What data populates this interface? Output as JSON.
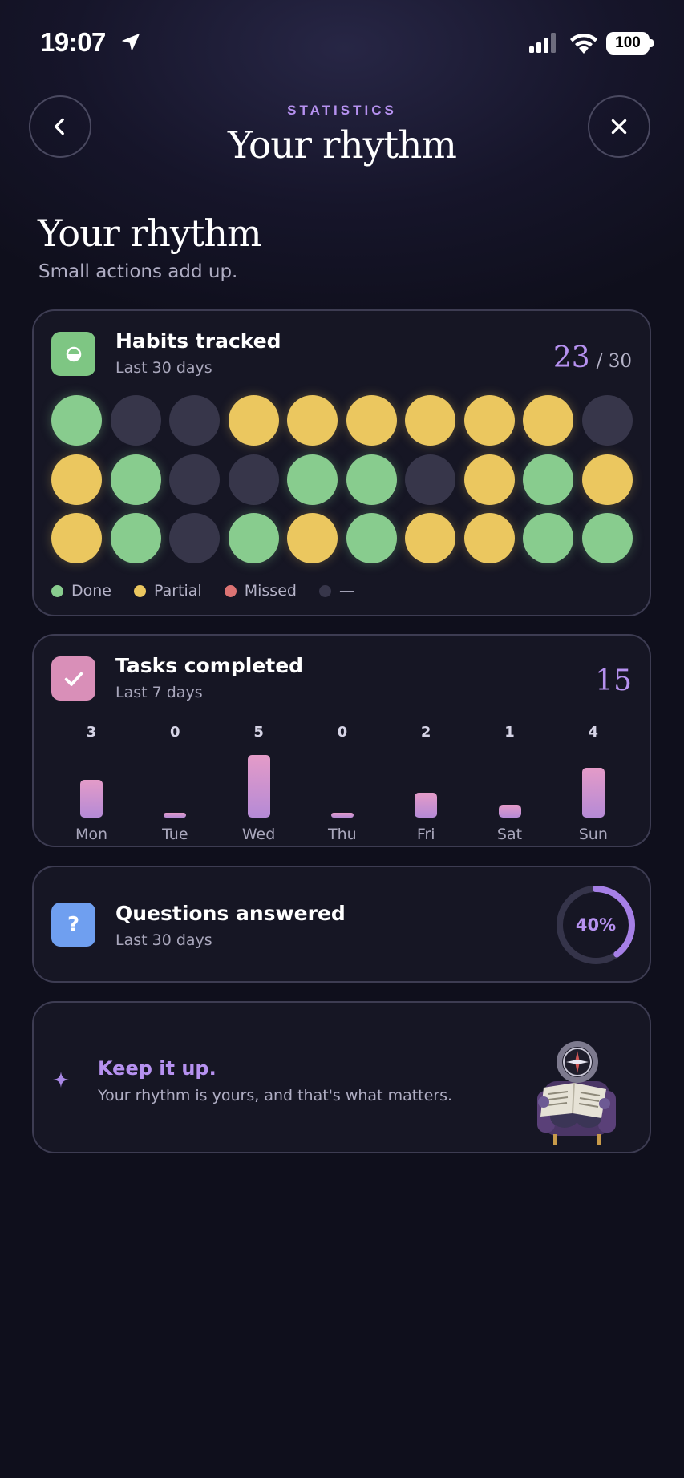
{
  "status_bar": {
    "time": "19:07",
    "battery": "100"
  },
  "header": {
    "kicker": "STATISTICS",
    "title": "Your rhythm"
  },
  "page": {
    "title": "Your rhythm",
    "subtitle": "Small actions add up."
  },
  "habits": {
    "title": "Habits tracked",
    "period": "Last 30 days",
    "count": "23",
    "total": "/ 30",
    "grid": [
      [
        "done",
        "none",
        "none",
        "partial",
        "partial",
        "partial",
        "partial",
        "partial",
        "partial",
        "none"
      ],
      [
        "partial",
        "done",
        "none",
        "none",
        "done",
        "done",
        "none",
        "partial",
        "done",
        "partial"
      ],
      [
        "partial",
        "done",
        "none",
        "done",
        "partial",
        "done",
        "partial",
        "partial",
        "done",
        "done"
      ]
    ],
    "legend": [
      {
        "key": "done",
        "label": "Done",
        "color": "#88cc8e"
      },
      {
        "key": "partial",
        "label": "Partial",
        "color": "#ebc75f"
      },
      {
        "key": "missed",
        "label": "Missed",
        "color": "#dc7373"
      },
      {
        "key": "none",
        "label": "—",
        "color": "#37364a"
      }
    ]
  },
  "tasks": {
    "title": "Tasks completed",
    "period": "Last 7 days",
    "total": "15",
    "chart_data": {
      "type": "bar",
      "categories": [
        "Mon",
        "Tue",
        "Wed",
        "Thu",
        "Fri",
        "Sat",
        "Sun"
      ],
      "values": [
        3,
        0,
        5,
        0,
        2,
        1,
        4
      ]
    }
  },
  "questions": {
    "title": "Questions answered",
    "period": "Last 30 days",
    "percent_label": "40%",
    "percent": 40
  },
  "keep": {
    "title": "Keep it up.",
    "message": "Your rhythm is yours, and that's what matters."
  },
  "colors": {
    "accent": "#b691f0",
    "habit_icon": "#7ec683",
    "task_icon": "#d98fb8",
    "question_icon": "#6f9ff0"
  }
}
